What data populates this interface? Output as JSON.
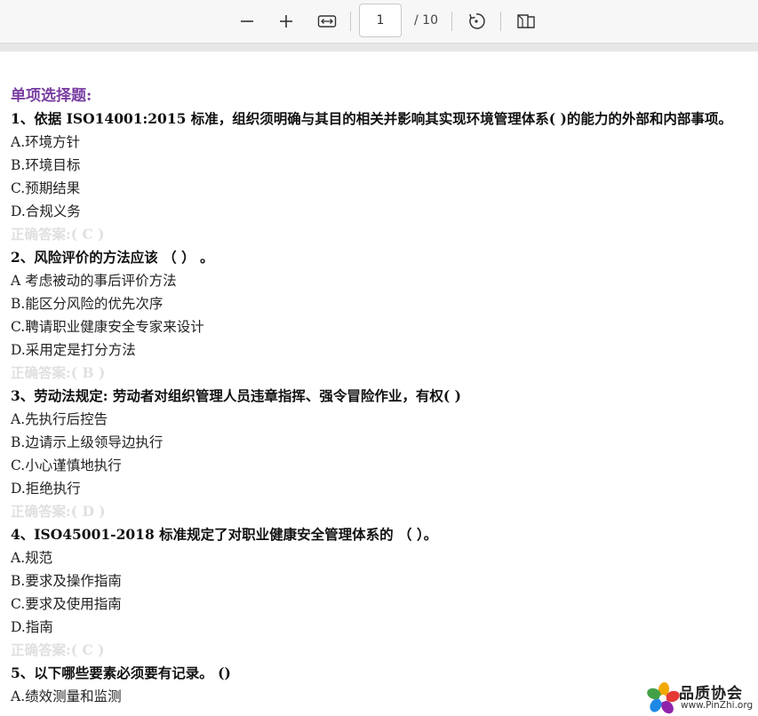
{
  "toolbar": {
    "current_page": "1",
    "total_pages": "/ 10",
    "icons": [
      "zoom-out-icon",
      "zoom-in-icon",
      "fit-width-icon",
      "rotate-icon",
      "two-page-view-icon"
    ]
  },
  "document": {
    "heading": "单项选择题:",
    "questions": [
      {
        "text": "1、依据 ISO14001:2015 标准，组织须明确与其目的相关并影响其实现环境管理体系( )的能力的外部和内部事项。",
        "options": [
          "A.环境方针",
          "B.环境目标",
          "C.预期结果",
          "D.合规义务"
        ],
        "answer": "正确答案:( C )"
      },
      {
        "text": "2、风险评价的方法应该 （  ） 。",
        "options": [
          "A 考虑被动的事后评价方法",
          "B.能区分风险的优先次序",
          "C.聘请职业健康安全专家来设计",
          "D.采用定是打分方法"
        ],
        "answer": "正确答案:( B )"
      },
      {
        "text": "3、劳动法规定: 劳动者对组织管理人员违章指挥、强令冒险作业，有权(  )",
        "options": [
          "A.先执行后控告",
          "B.边请示上级领导边执行",
          "C.小心谨慎地执行",
          "D.拒绝执行"
        ],
        "answer": "正确答案:( D )"
      },
      {
        "text": "4、ISO45001-2018 标准规定了对职业健康安全管理体系的 （  ）。",
        "options": [
          "A.规范",
          "B.要求及操作指南",
          "C.要求及使用指南",
          "D.指南"
        ],
        "answer": "正确答案:( C )"
      },
      {
        "text": "5、以下哪些要素必须要有记录。 ()",
        "options": [
          "A.绩效测量和监测"
        ],
        "answer": ""
      }
    ]
  },
  "watermark": {
    "title": "品质协会",
    "url": "www.PinZhi.org"
  },
  "colors": {
    "heading": "#7a3fa2",
    "answer": "#e0e0e0",
    "text": "#222222",
    "toolbar_bg": "#f7f7f7"
  }
}
